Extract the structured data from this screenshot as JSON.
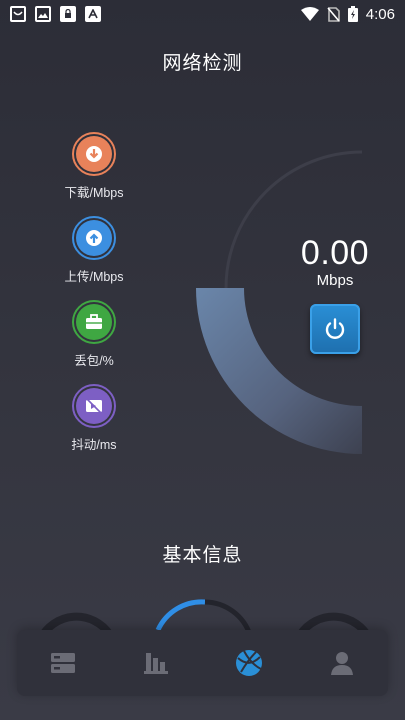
{
  "status_bar": {
    "time": "4:06",
    "notification_icons": [
      "shop-icon",
      "image-icon",
      "lock-icon",
      "text-a-icon"
    ],
    "system_icons": [
      "wifi-icon",
      "no-sim-icon",
      "battery-charging-icon"
    ]
  },
  "header": {
    "title": "网络检测"
  },
  "metrics": [
    {
      "label": "下载/Mbps",
      "icon": "download-icon",
      "color": "#e8825a"
    },
    {
      "label": "上传/Mbps",
      "icon": "upload-icon",
      "color": "#3c8fe0"
    },
    {
      "label": "丢包/%",
      "icon": "briefcase-icon",
      "color": "#3fa742"
    },
    {
      "label": "抖动/ms",
      "icon": "video-off-icon",
      "color": "#7d5fc4"
    }
  ],
  "gauge": {
    "speed_value": "0.00",
    "speed_unit": "Mbps"
  },
  "basic_info": {
    "title": "基本信息"
  },
  "bottom_nav": {
    "items": [
      {
        "icon": "server-icon",
        "active": false
      },
      {
        "icon": "bar-chart-icon",
        "active": false
      },
      {
        "icon": "globe-icon",
        "active": true
      },
      {
        "icon": "user-icon",
        "active": false
      }
    ]
  },
  "colors": {
    "background": "#2c2d37",
    "accent_blue": "#2a8fd6",
    "nav_inactive": "#6b6c76"
  }
}
